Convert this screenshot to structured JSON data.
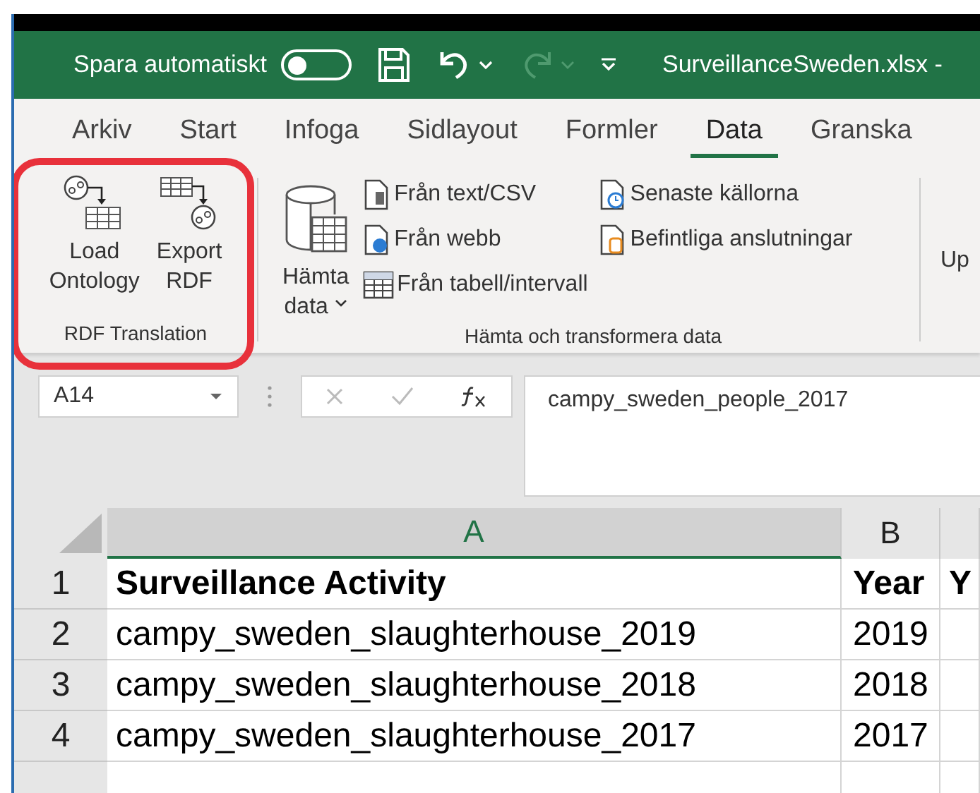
{
  "title_bar": {
    "autosave_label": "Spara automatiskt",
    "autosave_on": false,
    "filename": "SurveillanceSweden.xlsx -"
  },
  "tabs": [
    {
      "label": "Arkiv",
      "selected": false
    },
    {
      "label": "Start",
      "selected": false
    },
    {
      "label": "Infoga",
      "selected": false
    },
    {
      "label": "Sidlayout",
      "selected": false
    },
    {
      "label": "Formler",
      "selected": false
    },
    {
      "label": "Data",
      "selected": true
    },
    {
      "label": "Granska",
      "selected": false
    }
  ],
  "rdf_group": {
    "label": "RDF Translation",
    "highlighted": true,
    "buttons": [
      {
        "kind": "load",
        "lines": [
          "Load",
          "Ontology"
        ]
      },
      {
        "kind": "export",
        "lines": [
          "Export",
          "RDF"
        ]
      }
    ]
  },
  "get_data_group": {
    "label": "Hämta och transformera data",
    "big_button": {
      "lines": [
        "Hämta",
        "data"
      ]
    },
    "column_1": [
      {
        "kind": "text",
        "label": "Från text/CSV"
      },
      {
        "kind": "web",
        "label": "Från webb"
      },
      {
        "kind": "table",
        "label": "Från tabell/intervall"
      }
    ],
    "column_2": [
      {
        "kind": "recent",
        "label": "Senaste källorna"
      },
      {
        "kind": "connections",
        "label": "Befintliga anslutningar"
      }
    ]
  },
  "partial_group": {
    "label": "Up"
  },
  "formula_bar": {
    "name_box": "A14",
    "content": "campy_sweden_people_2017"
  },
  "sheet": {
    "columns": [
      {
        "label": "A",
        "selected": true
      },
      {
        "label": "B",
        "selected": false
      }
    ],
    "rows": [
      {
        "number": "1",
        "kind": "header",
        "cells": [
          "Surveillance Activity",
          "Year",
          "Y"
        ]
      },
      {
        "number": "2",
        "kind": "data",
        "cells": [
          "campy_sweden_slaughterhouse_2019",
          "2019"
        ]
      },
      {
        "number": "3",
        "kind": "data",
        "cells": [
          "campy_sweden_slaughterhouse_2018",
          "2018"
        ]
      },
      {
        "number": "4",
        "kind": "data",
        "cells": [
          "campy_sweden_slaughterhouse_2017",
          "2017"
        ]
      }
    ]
  }
}
